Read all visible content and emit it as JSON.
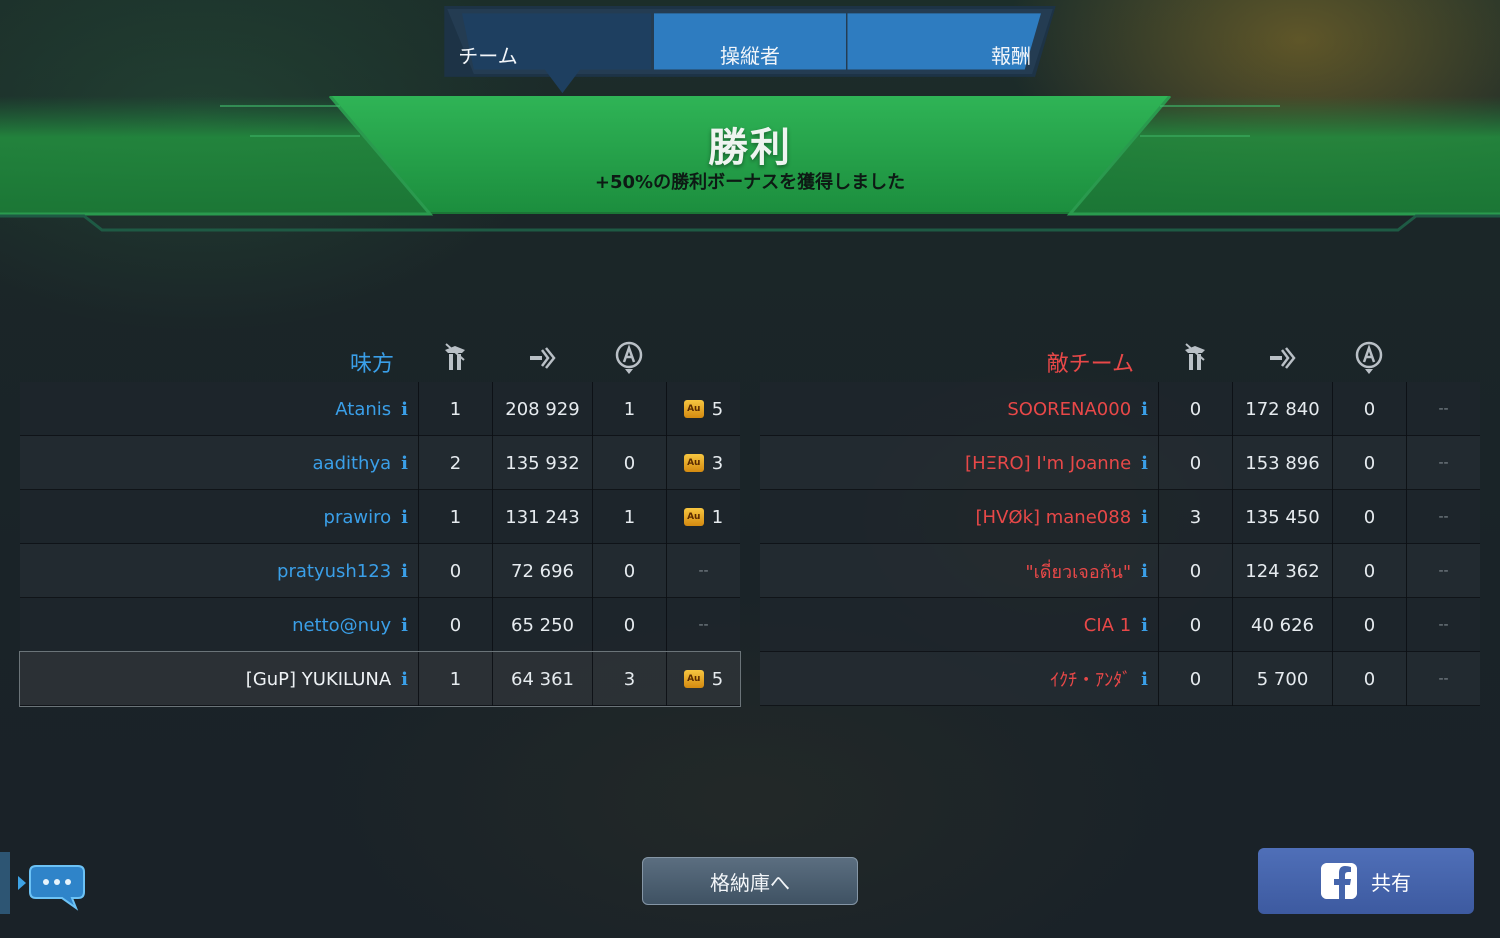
{
  "tabs": [
    {
      "label": "チーム",
      "active": true
    },
    {
      "label": "操縦者",
      "active": false
    },
    {
      "label": "報酬",
      "active": false
    }
  ],
  "result": {
    "title": "勝利",
    "subtitle": "+50%の勝利ボーナスを獲得しました"
  },
  "ally": {
    "label": "味方",
    "rows": [
      {
        "name": "Atanis",
        "c1": "1",
        "c2": "208 929",
        "c3": "1",
        "medal": "Au",
        "c4": "5"
      },
      {
        "name": "aadithya",
        "c1": "2",
        "c2": "135 932",
        "c3": "0",
        "medal": "Au",
        "c4": "3"
      },
      {
        "name": "prawiro",
        "c1": "1",
        "c2": "131 243",
        "c3": "1",
        "medal": "Au",
        "c4": "1"
      },
      {
        "name": "pratyush123",
        "c1": "0",
        "c2": "72 696",
        "c3": "0",
        "medal": "",
        "c4": "--"
      },
      {
        "name": "netto@nuy",
        "c1": "0",
        "c2": "65 250",
        "c3": "0",
        "medal": "",
        "c4": "--"
      },
      {
        "name": "[GuP] YUKILUNA",
        "c1": "1",
        "c2": "64 361",
        "c3": "3",
        "medal": "Au",
        "c4": "5"
      }
    ]
  },
  "enemy": {
    "label": "敵チーム",
    "rows": [
      {
        "name": "SOORENA000",
        "c1": "0",
        "c2": "172 840",
        "c3": "0",
        "c4": "--"
      },
      {
        "name": "[HΞRO] I'm Joanne",
        "c1": "0",
        "c2": "153 896",
        "c3": "0",
        "c4": "--"
      },
      {
        "name": "[HVØk] mane088",
        "c1": "3",
        "c2": "135 450",
        "c3": "0",
        "c4": "--"
      },
      {
        "name": "\"เดี่ยวเจอกัน\"",
        "c1": "0",
        "c2": "124 362",
        "c3": "0",
        "c4": "--"
      },
      {
        "name": "CIA 1",
        "c1": "0",
        "c2": "40 626",
        "c3": "0",
        "c4": "--"
      },
      {
        "name": "ｲｸﾁ・ｱﾝﾀﾞ",
        "c1": "0",
        "c2": "5 700",
        "c3": "0",
        "c4": "--"
      }
    ]
  },
  "info_glyph": "i",
  "buttons": {
    "vault": "格納庫へ",
    "share": "共有"
  },
  "icons": {
    "col1": "kills-robot-icon",
    "col2": "damage-icon",
    "col3": "beacon-capture-icon",
    "chat": "chat-bubble-icon",
    "share": "facebook-icon"
  },
  "colors": {
    "ally": "#3a9fe8",
    "enemy": "#e84848",
    "victory_green": "#22a24a",
    "tab_blue": "#2d7fc2",
    "share_blue": "#4565ac"
  }
}
